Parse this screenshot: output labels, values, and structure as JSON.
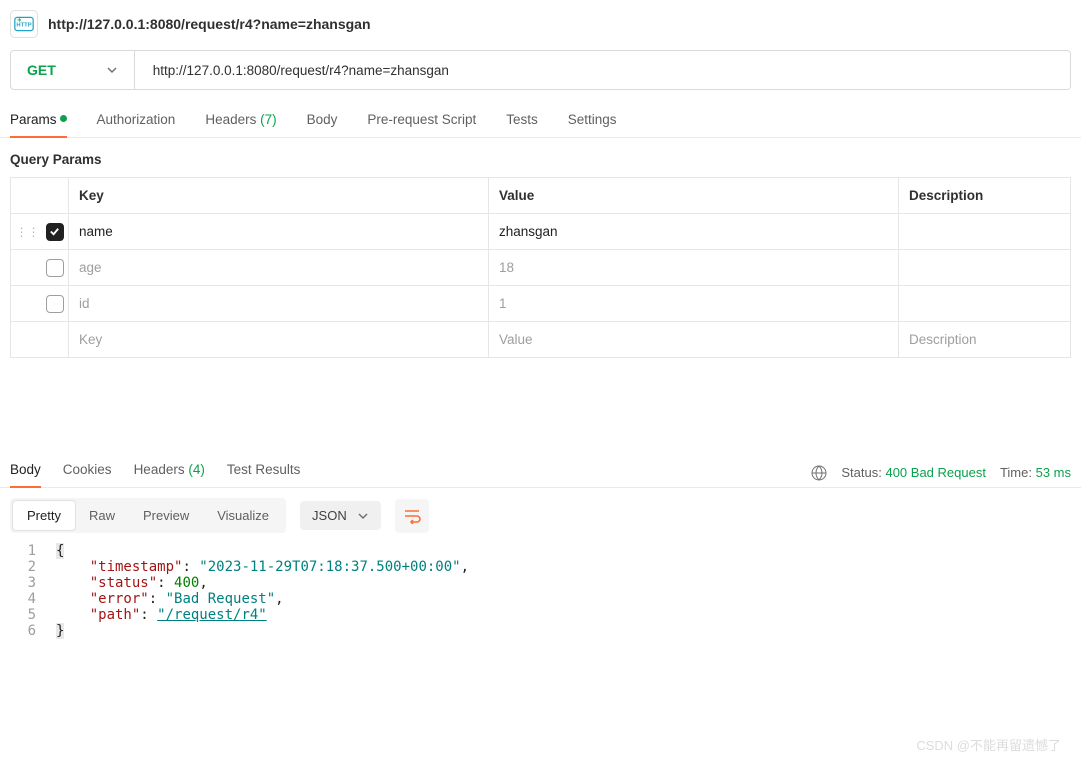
{
  "title": "http://127.0.0.1:8080/request/r4?name=zhansgan",
  "request": {
    "method": "GET",
    "url": "http://127.0.0.1:8080/request/r4?name=zhansgan"
  },
  "tabs": {
    "params": "Params",
    "authorization": "Authorization",
    "headers": "Headers",
    "headers_count": "(7)",
    "body": "Body",
    "prerequest": "Pre-request Script",
    "tests": "Tests",
    "settings": "Settings"
  },
  "section_label": "Query Params",
  "table": {
    "head": {
      "key": "Key",
      "value": "Value",
      "desc": "Description"
    },
    "rows": [
      {
        "checked": true,
        "key": "name",
        "value": "zhansgan",
        "desc": ""
      },
      {
        "checked": false,
        "key": "age",
        "value": "18",
        "desc": ""
      },
      {
        "checked": false,
        "key": "id",
        "value": "1",
        "desc": ""
      }
    ],
    "placeholder": {
      "key": "Key",
      "value": "Value",
      "desc": "Description"
    }
  },
  "response": {
    "tabs": {
      "body": "Body",
      "cookies": "Cookies",
      "headers": "Headers",
      "headers_count": "(4)",
      "tests": "Test Results"
    },
    "status_label": "Status:",
    "status_value": "400 Bad Request",
    "time_label": "Time:",
    "time_value": "53 ms",
    "views": {
      "pretty": "Pretty",
      "raw": "Raw",
      "preview": "Preview",
      "visualize": "Visualize"
    },
    "format": "JSON",
    "body": {
      "timestamp_k": "\"timestamp\"",
      "timestamp_v": "\"2023-11-29T07:18:37.500+00:00\"",
      "status_k": "\"status\"",
      "status_v": "400",
      "error_k": "\"error\"",
      "error_v": "\"Bad Request\"",
      "path_k": "\"path\"",
      "path_v": "\"/request/r4\"",
      "ln1": "1",
      "ln2": "2",
      "ln3": "3",
      "ln4": "4",
      "ln5": "5",
      "ln6": "6",
      "ob": "{",
      "cb": "}"
    }
  },
  "watermark": "CSDN @不能再留遗憾了"
}
